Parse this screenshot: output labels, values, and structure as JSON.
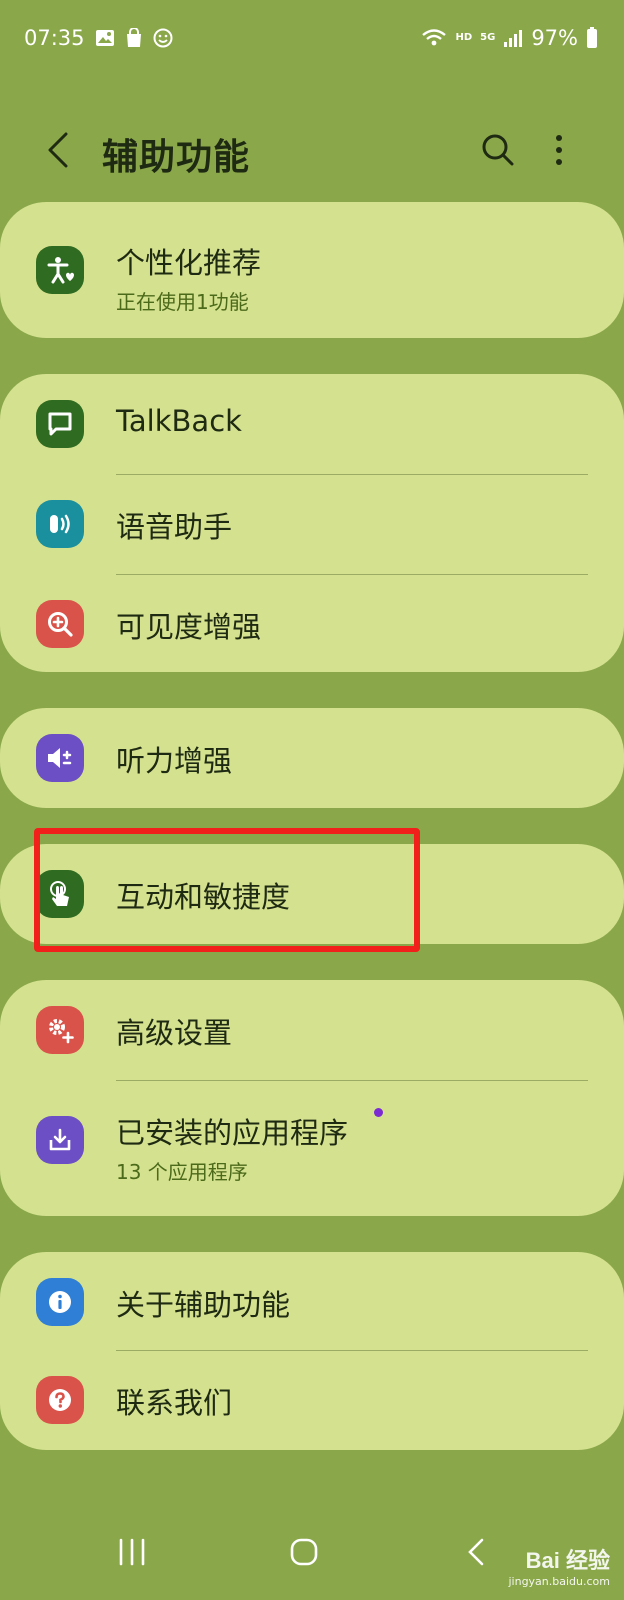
{
  "status_bar": {
    "time": "07:35",
    "network": "HD",
    "signal": "5G",
    "battery": "97%"
  },
  "header": {
    "title": "辅助功能"
  },
  "groups": [
    {
      "items": [
        {
          "label": "个性化推荐",
          "sub": "正在使用1功能",
          "icon": "accessibility-person-icon",
          "color": "#2f6b20"
        }
      ]
    },
    {
      "items": [
        {
          "label": "TalkBack",
          "icon": "chat-bubble-icon",
          "color": "#2f6b20"
        },
        {
          "label": "语音助手",
          "icon": "voice-assistant-icon",
          "color": "#1a8f9e"
        },
        {
          "label": "可见度增强",
          "icon": "magnify-plus-icon",
          "color": "#d9534a"
        }
      ]
    },
    {
      "items": [
        {
          "label": "听力增强",
          "icon": "volume-plus-icon",
          "color": "#6c4fc4"
        }
      ]
    },
    {
      "items": [
        {
          "label": "互动和敏捷度",
          "icon": "touch-hand-icon",
          "color": "#2f6b20"
        }
      ]
    },
    {
      "items": [
        {
          "label": "高级设置",
          "icon": "gear-plus-icon",
          "color": "#d9534a"
        },
        {
          "label": "已安装的应用程序",
          "sub": "13 个应用程序",
          "icon": "download-box-icon",
          "color": "#6c4fc4"
        }
      ]
    },
    {
      "items": [
        {
          "label": "关于辅助功能",
          "icon": "info-icon",
          "color": "#2f7fd6"
        },
        {
          "label": "联系我们",
          "icon": "question-icon",
          "color": "#d9534a"
        }
      ]
    }
  ],
  "watermark": {
    "brand": "Bai 经验",
    "url": "jingyan.baidu.com"
  },
  "colors": {
    "background": "#8aa74a",
    "card": "#d4e18f",
    "highlight": "#f2201a"
  }
}
